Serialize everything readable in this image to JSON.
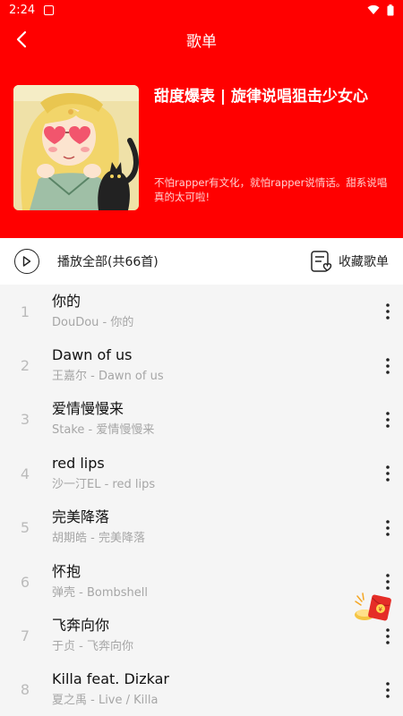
{
  "status_bar": {
    "time": "2:24"
  },
  "app_bar": {
    "title": "歌单"
  },
  "playlist": {
    "title": "甜度爆表 | 旋律说唱狙击少女心",
    "description": "不怕rapper有文化，就怕rapper说情话。甜系说唱真的太可啦!"
  },
  "actions": {
    "play_all": "播放全部(共66首)",
    "collect": "收藏歌单"
  },
  "songs": [
    {
      "index": "1",
      "title": "你的",
      "subtitle": "DouDou - 你的"
    },
    {
      "index": "2",
      "title": "Dawn of us",
      "subtitle": "王嘉尔 - Dawn of us"
    },
    {
      "index": "3",
      "title": "爱情慢慢来",
      "subtitle": "Stake - 爱情慢慢来"
    },
    {
      "index": "4",
      "title": "red lips",
      "subtitle": "沙一汀EL - red lips"
    },
    {
      "index": "5",
      "title": "完美降落",
      "subtitle": "胡期皓 - 完美降落"
    },
    {
      "index": "6",
      "title": "怀抱",
      "subtitle": "弹壳 - Bombshell"
    },
    {
      "index": "7",
      "title": "飞奔向你",
      "subtitle": "于贞 - 飞奔向你"
    },
    {
      "index": "8",
      "title": "Killa feat. Dizkar",
      "subtitle": "夏之禹 - Live / Killa"
    }
  ],
  "icons": {
    "back": "back-arrow-icon",
    "play": "play-circle-icon",
    "collect": "collect-list-icon",
    "more": "more-vertical-icon",
    "wifi": "wifi-icon",
    "battery": "battery-icon",
    "red_packet": "red-packet-icon"
  },
  "colors": {
    "theme_red": "#ff0000",
    "text_primary": "#111111",
    "text_secondary": "#a6a6a6",
    "list_bg": "#f5f5f5"
  }
}
